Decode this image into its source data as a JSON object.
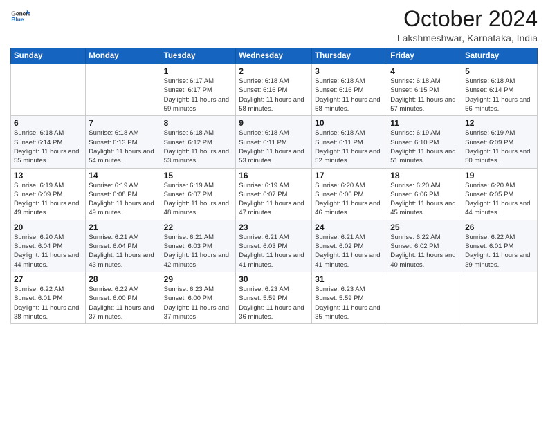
{
  "logo": {
    "text1": "General",
    "text2": "Blue"
  },
  "header": {
    "month": "October 2024",
    "location": "Lakshmeshwar, Karnataka, India"
  },
  "weekdays": [
    "Sunday",
    "Monday",
    "Tuesday",
    "Wednesday",
    "Thursday",
    "Friday",
    "Saturday"
  ],
  "weeks": [
    [
      {
        "day": "",
        "info": ""
      },
      {
        "day": "",
        "info": ""
      },
      {
        "day": "1",
        "info": "Sunrise: 6:17 AM\nSunset: 6:17 PM\nDaylight: 11 hours\nand 59 minutes."
      },
      {
        "day": "2",
        "info": "Sunrise: 6:18 AM\nSunset: 6:16 PM\nDaylight: 11 hours\nand 58 minutes."
      },
      {
        "day": "3",
        "info": "Sunrise: 6:18 AM\nSunset: 6:16 PM\nDaylight: 11 hours\nand 58 minutes."
      },
      {
        "day": "4",
        "info": "Sunrise: 6:18 AM\nSunset: 6:15 PM\nDaylight: 11 hours\nand 57 minutes."
      },
      {
        "day": "5",
        "info": "Sunrise: 6:18 AM\nSunset: 6:14 PM\nDaylight: 11 hours\nand 56 minutes."
      }
    ],
    [
      {
        "day": "6",
        "info": "Sunrise: 6:18 AM\nSunset: 6:14 PM\nDaylight: 11 hours\nand 55 minutes."
      },
      {
        "day": "7",
        "info": "Sunrise: 6:18 AM\nSunset: 6:13 PM\nDaylight: 11 hours\nand 54 minutes."
      },
      {
        "day": "8",
        "info": "Sunrise: 6:18 AM\nSunset: 6:12 PM\nDaylight: 11 hours\nand 53 minutes."
      },
      {
        "day": "9",
        "info": "Sunrise: 6:18 AM\nSunset: 6:11 PM\nDaylight: 11 hours\nand 53 minutes."
      },
      {
        "day": "10",
        "info": "Sunrise: 6:18 AM\nSunset: 6:11 PM\nDaylight: 11 hours\nand 52 minutes."
      },
      {
        "day": "11",
        "info": "Sunrise: 6:19 AM\nSunset: 6:10 PM\nDaylight: 11 hours\nand 51 minutes."
      },
      {
        "day": "12",
        "info": "Sunrise: 6:19 AM\nSunset: 6:09 PM\nDaylight: 11 hours\nand 50 minutes."
      }
    ],
    [
      {
        "day": "13",
        "info": "Sunrise: 6:19 AM\nSunset: 6:09 PM\nDaylight: 11 hours\nand 49 minutes."
      },
      {
        "day": "14",
        "info": "Sunrise: 6:19 AM\nSunset: 6:08 PM\nDaylight: 11 hours\nand 49 minutes."
      },
      {
        "day": "15",
        "info": "Sunrise: 6:19 AM\nSunset: 6:07 PM\nDaylight: 11 hours\nand 48 minutes."
      },
      {
        "day": "16",
        "info": "Sunrise: 6:19 AM\nSunset: 6:07 PM\nDaylight: 11 hours\nand 47 minutes."
      },
      {
        "day": "17",
        "info": "Sunrise: 6:20 AM\nSunset: 6:06 PM\nDaylight: 11 hours\nand 46 minutes."
      },
      {
        "day": "18",
        "info": "Sunrise: 6:20 AM\nSunset: 6:06 PM\nDaylight: 11 hours\nand 45 minutes."
      },
      {
        "day": "19",
        "info": "Sunrise: 6:20 AM\nSunset: 6:05 PM\nDaylight: 11 hours\nand 44 minutes."
      }
    ],
    [
      {
        "day": "20",
        "info": "Sunrise: 6:20 AM\nSunset: 6:04 PM\nDaylight: 11 hours\nand 44 minutes."
      },
      {
        "day": "21",
        "info": "Sunrise: 6:21 AM\nSunset: 6:04 PM\nDaylight: 11 hours\nand 43 minutes."
      },
      {
        "day": "22",
        "info": "Sunrise: 6:21 AM\nSunset: 6:03 PM\nDaylight: 11 hours\nand 42 minutes."
      },
      {
        "day": "23",
        "info": "Sunrise: 6:21 AM\nSunset: 6:03 PM\nDaylight: 11 hours\nand 41 minutes."
      },
      {
        "day": "24",
        "info": "Sunrise: 6:21 AM\nSunset: 6:02 PM\nDaylight: 11 hours\nand 41 minutes."
      },
      {
        "day": "25",
        "info": "Sunrise: 6:22 AM\nSunset: 6:02 PM\nDaylight: 11 hours\nand 40 minutes."
      },
      {
        "day": "26",
        "info": "Sunrise: 6:22 AM\nSunset: 6:01 PM\nDaylight: 11 hours\nand 39 minutes."
      }
    ],
    [
      {
        "day": "27",
        "info": "Sunrise: 6:22 AM\nSunset: 6:01 PM\nDaylight: 11 hours\nand 38 minutes."
      },
      {
        "day": "28",
        "info": "Sunrise: 6:22 AM\nSunset: 6:00 PM\nDaylight: 11 hours\nand 37 minutes."
      },
      {
        "day": "29",
        "info": "Sunrise: 6:23 AM\nSunset: 6:00 PM\nDaylight: 11 hours\nand 37 minutes."
      },
      {
        "day": "30",
        "info": "Sunrise: 6:23 AM\nSunset: 5:59 PM\nDaylight: 11 hours\nand 36 minutes."
      },
      {
        "day": "31",
        "info": "Sunrise: 6:23 AM\nSunset: 5:59 PM\nDaylight: 11 hours\nand 35 minutes."
      },
      {
        "day": "",
        "info": ""
      },
      {
        "day": "",
        "info": ""
      }
    ]
  ]
}
